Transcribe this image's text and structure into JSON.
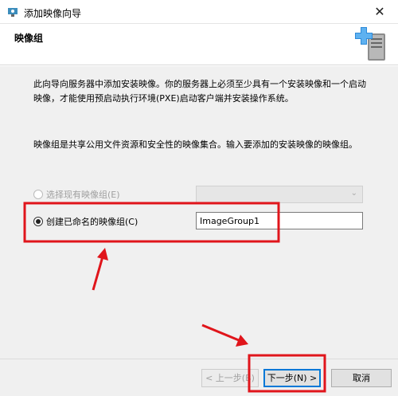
{
  "window": {
    "title": "添加映像向导"
  },
  "header": {
    "title": "映像组"
  },
  "content": {
    "description": "此向导向服务器中添加安装映像。你的服务器上必须至少具有一个安装映像和一个启动映像，才能使用预启动执行环境(PXE)启动客户端并安装操作系统。",
    "group_description": "映像组是共享公用文件资源和安全性的映像集合。输入要添加的安装映像的映像组。",
    "option_existing": {
      "label": "选择现有映像组(E)",
      "enabled": false,
      "selected": false
    },
    "option_new": {
      "label": "创建已命名的映像组(C)",
      "enabled": true,
      "selected": true
    },
    "existing_group_value": "",
    "new_group_value": "ImageGroup1"
  },
  "buttons": {
    "back": "< 上一步(B)",
    "next": "下一步(N) >",
    "cancel": "取消"
  },
  "annotation": {
    "color": "#e0151b"
  }
}
